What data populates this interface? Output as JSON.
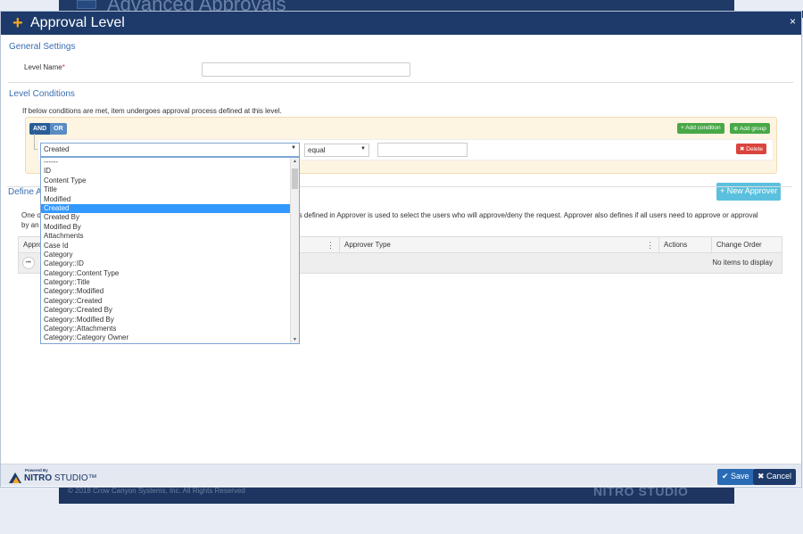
{
  "background_app": {
    "title": "Advanced Approvals",
    "copyright": "© 2018 Crow Canyon Systems, Inc. All Rights Reserved",
    "logo": "NITRO STUDIO"
  },
  "modal": {
    "title": "Approval Level",
    "plus_icon": "+",
    "close_icon": "×"
  },
  "general_settings": {
    "title": "General Settings",
    "level_name_label": "Level Name",
    "required_mark": "*",
    "level_name_value": ""
  },
  "level_conditions": {
    "title": "Level Conditions",
    "description": "If below conditions are met, item undergoes approval process defined at this level.",
    "and_label": "AND",
    "or_label": "OR",
    "add_condition_label": "+ Add condition",
    "add_group_label": "⊕ Add group",
    "field_selected": "Created",
    "operator_selected": "equal",
    "value": "",
    "delete_label": "✖ Delete",
    "dropdown_options": [
      "------",
      "ID",
      "Content Type",
      "Title",
      "Modified",
      "Created",
      "Created By",
      "Modified By",
      "Attachments",
      "Case Id",
      "Category",
      "Category::ID",
      "Category::Content Type",
      "Category::Title",
      "Category::Modified",
      "Category::Created",
      "Category::Created By",
      "Category::Modified By",
      "Category::Attachments",
      "Category::Category Owner"
    ],
    "dropdown_selected_index": 5
  },
  "define_approvers": {
    "title": "Define A",
    "new_approver_label": "+ New Approver",
    "description_start": "One o",
    "description_end": "ons defined in Approver is used to select the users who will approve/deny the request. Approver also defines if all users need to approve or approval",
    "description_line2": "by an",
    "columns": [
      "Appro",
      "Approver Type",
      "Actions",
      "Change Order"
    ],
    "empty_text": "No items to display"
  },
  "footer": {
    "powered_by": "Powered By",
    "brand_nitro": "NITRO",
    "brand_studio": " STUDIO™",
    "save_label": "✔ Save",
    "cancel_label": "✖ Cancel"
  }
}
